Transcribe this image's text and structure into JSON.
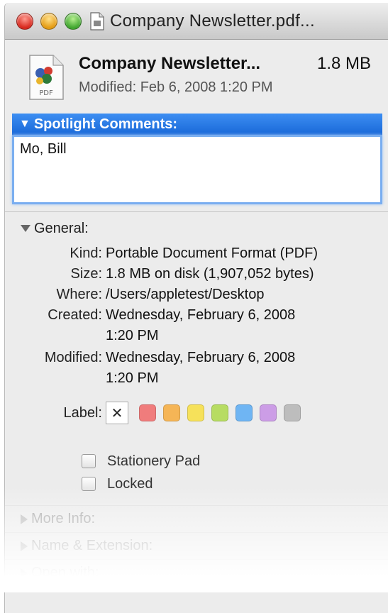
{
  "window": {
    "title": "Company Newsletter.pdf..."
  },
  "header": {
    "file_name": "Company Newsletter...",
    "size": "1.8 MB",
    "modified": "Modified: Feb 6, 2008 1:20 PM",
    "icon_label": "PDF"
  },
  "spotlight": {
    "title": "Spotlight Comments:",
    "comment": "Mo, Bill"
  },
  "general": {
    "title": "General:",
    "rows": [
      {
        "key": "Kind:",
        "value": "Portable Document Format (PDF)"
      },
      {
        "key": "Size:",
        "value": "1.8 MB on disk (1,907,052 bytes)"
      },
      {
        "key": "Where:",
        "value": "/Users/appletest/Desktop"
      },
      {
        "key": "Created:",
        "value": "Wednesday, February 6, 2008",
        "value2": "1:20 PM"
      },
      {
        "key": "Modified:",
        "value": "Wednesday, February 6, 2008",
        "value2": "1:20 PM"
      }
    ],
    "label_key": "Label:",
    "label_none": "✕",
    "label_colors": [
      "#f07c7c",
      "#f5b556",
      "#f6e15a",
      "#b7dc62",
      "#6fb5f3",
      "#cc9de6",
      "#bdbdbd"
    ],
    "stationery": "Stationery Pad",
    "locked": "Locked"
  },
  "sections": {
    "more_info": "More Info:",
    "name_ext": "Name & Extension:",
    "open_with": "Open with:"
  }
}
